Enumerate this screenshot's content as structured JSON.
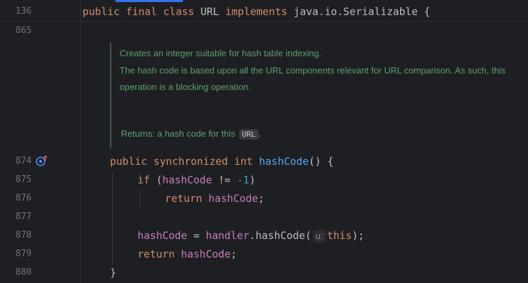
{
  "colors": {
    "background": "#1e1f22",
    "keyword": "#cf8e6d",
    "field": "#c77dbb",
    "method": "#56a8f5",
    "number": "#2aacb8",
    "plain": "#bcbec4",
    "doc_text": "#5f9e6e",
    "line_number": "#6f737a",
    "tab_accent": "#3574f0"
  },
  "sticky_header": {
    "line_number": "136",
    "tokens": {
      "public": "public",
      "final": "final",
      "class": "class",
      "name": "URL",
      "implements": "implements",
      "iface": "java.io.Serializable",
      "brace": "{"
    }
  },
  "line_numbers": {
    "l865": "865",
    "l874": "874",
    "l875": "875",
    "l876": "876",
    "l877": "877",
    "l878": "878",
    "l879": "879",
    "l880": "880"
  },
  "javadoc": {
    "summary": "Creates an integer suitable for hash table indexing.",
    "detail_line1": "The hash code is based upon all the URL components relevant for URL comparison. As such, this",
    "detail_line2": "operation is a blocking operation.",
    "returns_prefix": "Returns: a hash code for this",
    "returns_code": "URL",
    "returns_suffix": "."
  },
  "gutter_icons": {
    "override_icon": "overrides-method-icon"
  },
  "code": {
    "l874": {
      "public": "public",
      "synchronized": "synchronized",
      "int": "int",
      "method": "hashCode",
      "rest": "() {"
    },
    "l875": {
      "if": "if",
      "open": " (",
      "field": "hashCode",
      "op": " != ",
      "num": "-1",
      "close": ")"
    },
    "l876": {
      "return": "return",
      "field": "hashCode",
      "semi": ";"
    },
    "l878": {
      "field": "hashCode",
      "eq": " = ",
      "handler": "handler",
      "call": ".hashCode(",
      "hint": "u:",
      "this": "this",
      "end": ");"
    },
    "l879": {
      "return": "return",
      "field": "hashCode",
      "semi": ";"
    },
    "l880": {
      "brace": "}"
    }
  }
}
